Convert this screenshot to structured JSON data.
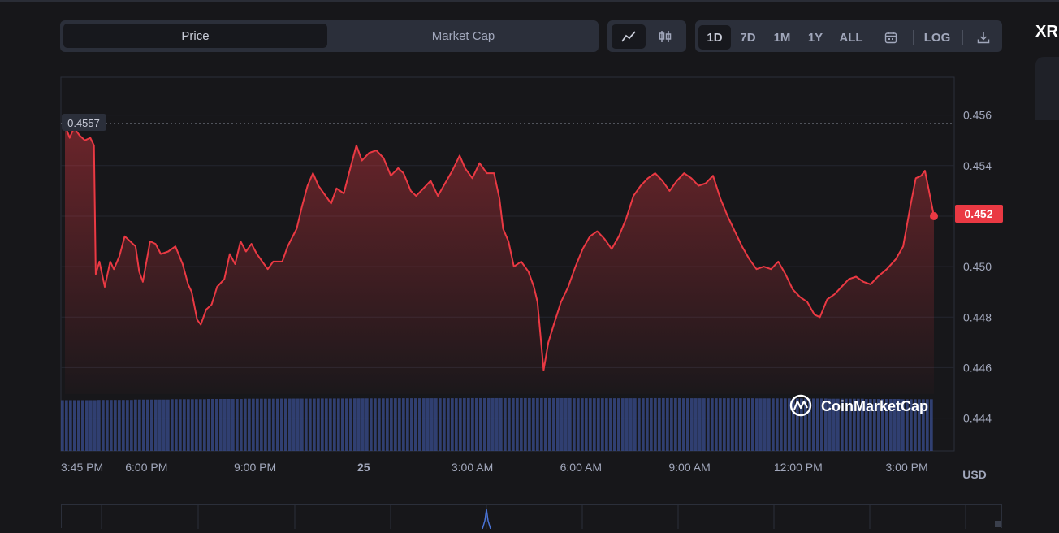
{
  "tabs": {
    "price": "Price",
    "market_cap": "Market Cap"
  },
  "chart_type_icons": [
    "line-chart-icon",
    "candlestick-icon"
  ],
  "timeframes": [
    "1D",
    "7D",
    "1M",
    "1Y",
    "ALL"
  ],
  "active_timeframe": "1D",
  "log_label": "LOG",
  "coin_label": "XR",
  "chart_data": {
    "type": "line",
    "start_label": "0.4557",
    "current_label": "0.452",
    "currency": "USD",
    "watermark": "CoinMarketCap",
    "colors": {
      "line": "#ea3943",
      "volume": "#3a4d8f",
      "label_bg": "#2b2f3a",
      "current_bg": "#ea3943"
    },
    "ylim": [
      0.4427,
      0.4575
    ],
    "y_ticks": [
      "0.456",
      "0.454",
      "0.452",
      "0.450",
      "0.448",
      "0.446",
      "0.444"
    ],
    "x_ticks": [
      "3:45 PM",
      "6:00 PM",
      "9:00 PM",
      "25",
      "3:00 AM",
      "6:00 AM",
      "9:00 AM",
      "12:00 PM",
      "3:00 PM",
      "USD"
    ],
    "x_range_hours": [
      0,
      24
    ],
    "x_tick_hours": [
      0,
      2.25,
      5.25,
      8.25,
      11.25,
      14.25,
      17.25,
      20.25,
      23.25
    ],
    "series": [
      {
        "values": [
          [
            0.0,
            0.4556
          ],
          [
            0.13,
            0.4551
          ],
          [
            0.25,
            0.4555
          ],
          [
            0.4,
            0.4552
          ],
          [
            0.55,
            0.455
          ],
          [
            0.7,
            0.4551
          ],
          [
            0.8,
            0.4548
          ],
          [
            0.85,
            0.4497
          ],
          [
            0.95,
            0.4502
          ],
          [
            1.1,
            0.4492
          ],
          [
            1.25,
            0.4502
          ],
          [
            1.35,
            0.4499
          ],
          [
            1.5,
            0.4504
          ],
          [
            1.65,
            0.4512
          ],
          [
            1.8,
            0.451
          ],
          [
            1.95,
            0.4508
          ],
          [
            2.05,
            0.4498
          ],
          [
            2.15,
            0.4494
          ],
          [
            2.35,
            0.451
          ],
          [
            2.5,
            0.4509
          ],
          [
            2.65,
            0.4505
          ],
          [
            2.85,
            0.4506
          ],
          [
            3.05,
            0.4508
          ],
          [
            3.25,
            0.4501
          ],
          [
            3.4,
            0.4493
          ],
          [
            3.5,
            0.449
          ],
          [
            3.65,
            0.4479
          ],
          [
            3.75,
            0.4477
          ],
          [
            3.9,
            0.4483
          ],
          [
            4.05,
            0.4485
          ],
          [
            4.2,
            0.4492
          ],
          [
            4.4,
            0.4495
          ],
          [
            4.55,
            0.4505
          ],
          [
            4.7,
            0.4501
          ],
          [
            4.85,
            0.451
          ],
          [
            5.0,
            0.4506
          ],
          [
            5.15,
            0.4509
          ],
          [
            5.3,
            0.4505
          ],
          [
            5.45,
            0.4502
          ],
          [
            5.6,
            0.4499
          ],
          [
            5.75,
            0.4502
          ],
          [
            6.0,
            0.4502
          ],
          [
            6.15,
            0.4508
          ],
          [
            6.4,
            0.4515
          ],
          [
            6.55,
            0.4524
          ],
          [
            6.7,
            0.4532
          ],
          [
            6.85,
            0.4537
          ],
          [
            7.0,
            0.4532
          ],
          [
            7.15,
            0.4529
          ],
          [
            7.35,
            0.4525
          ],
          [
            7.5,
            0.4531
          ],
          [
            7.7,
            0.4529
          ],
          [
            7.9,
            0.454
          ],
          [
            8.05,
            0.4548
          ],
          [
            8.2,
            0.4542
          ],
          [
            8.4,
            0.4545
          ],
          [
            8.6,
            0.4546
          ],
          [
            8.8,
            0.4543
          ],
          [
            9.0,
            0.4536
          ],
          [
            9.2,
            0.4539
          ],
          [
            9.35,
            0.4537
          ],
          [
            9.55,
            0.453
          ],
          [
            9.7,
            0.4528
          ],
          [
            9.9,
            0.4531
          ],
          [
            10.1,
            0.4534
          ],
          [
            10.3,
            0.4528
          ],
          [
            10.5,
            0.4533
          ],
          [
            10.7,
            0.4538
          ],
          [
            10.9,
            0.4544
          ],
          [
            11.05,
            0.4539
          ],
          [
            11.25,
            0.4535
          ],
          [
            11.45,
            0.4541
          ],
          [
            11.65,
            0.4537
          ],
          [
            11.85,
            0.4537
          ],
          [
            12.0,
            0.4527
          ],
          [
            12.1,
            0.4515
          ],
          [
            12.25,
            0.451
          ],
          [
            12.4,
            0.45
          ],
          [
            12.6,
            0.4502
          ],
          [
            12.8,
            0.4498
          ],
          [
            12.95,
            0.4492
          ],
          [
            13.05,
            0.4486
          ],
          [
            13.15,
            0.447
          ],
          [
            13.22,
            0.4459
          ],
          [
            13.35,
            0.447
          ],
          [
            13.5,
            0.4477
          ],
          [
            13.7,
            0.4486
          ],
          [
            13.9,
            0.4492
          ],
          [
            14.1,
            0.45
          ],
          [
            14.3,
            0.4507
          ],
          [
            14.5,
            0.4512
          ],
          [
            14.7,
            0.4514
          ],
          [
            14.9,
            0.4511
          ],
          [
            15.1,
            0.4507
          ],
          [
            15.3,
            0.4512
          ],
          [
            15.5,
            0.4519
          ],
          [
            15.7,
            0.4528
          ],
          [
            15.9,
            0.4532
          ],
          [
            16.1,
            0.4535
          ],
          [
            16.3,
            0.4537
          ],
          [
            16.5,
            0.4534
          ],
          [
            16.7,
            0.453
          ],
          [
            16.9,
            0.4534
          ],
          [
            17.1,
            0.4537
          ],
          [
            17.3,
            0.4535
          ],
          [
            17.5,
            0.4532
          ],
          [
            17.7,
            0.4533
          ],
          [
            17.9,
            0.4536
          ],
          [
            18.1,
            0.4527
          ],
          [
            18.3,
            0.452
          ],
          [
            18.5,
            0.4514
          ],
          [
            18.7,
            0.4508
          ],
          [
            18.9,
            0.4503
          ],
          [
            19.1,
            0.4499
          ],
          [
            19.3,
            0.45
          ],
          [
            19.5,
            0.4499
          ],
          [
            19.7,
            0.4502
          ],
          [
            19.9,
            0.4497
          ],
          [
            20.1,
            0.4491
          ],
          [
            20.3,
            0.4488
          ],
          [
            20.5,
            0.4486
          ],
          [
            20.7,
            0.4481
          ],
          [
            20.85,
            0.448
          ],
          [
            21.05,
            0.4487
          ],
          [
            21.25,
            0.4489
          ],
          [
            21.45,
            0.4492
          ],
          [
            21.65,
            0.4495
          ],
          [
            21.85,
            0.4496
          ],
          [
            22.05,
            0.4494
          ],
          [
            22.25,
            0.4493
          ],
          [
            22.45,
            0.4496
          ],
          [
            22.7,
            0.4499
          ],
          [
            22.95,
            0.4503
          ],
          [
            23.15,
            0.4508
          ],
          [
            23.35,
            0.4524
          ],
          [
            23.5,
            0.4535
          ],
          [
            23.65,
            0.4536
          ],
          [
            23.75,
            0.4538
          ],
          [
            23.85,
            0.4531
          ],
          [
            24.0,
            0.452
          ]
        ]
      }
    ],
    "volume_note": "relative volume bars",
    "volume": [
      0.5,
      0.52,
      0.55,
      0.58,
      0.6,
      0.62,
      0.63,
      0.64,
      0.65,
      0.66,
      0.66,
      0.67,
      0.67,
      0.67,
      0.66,
      0.66,
      0.67,
      0.66,
      0.66,
      0.65,
      0.64,
      0.62,
      0.6,
      0.58
    ]
  }
}
